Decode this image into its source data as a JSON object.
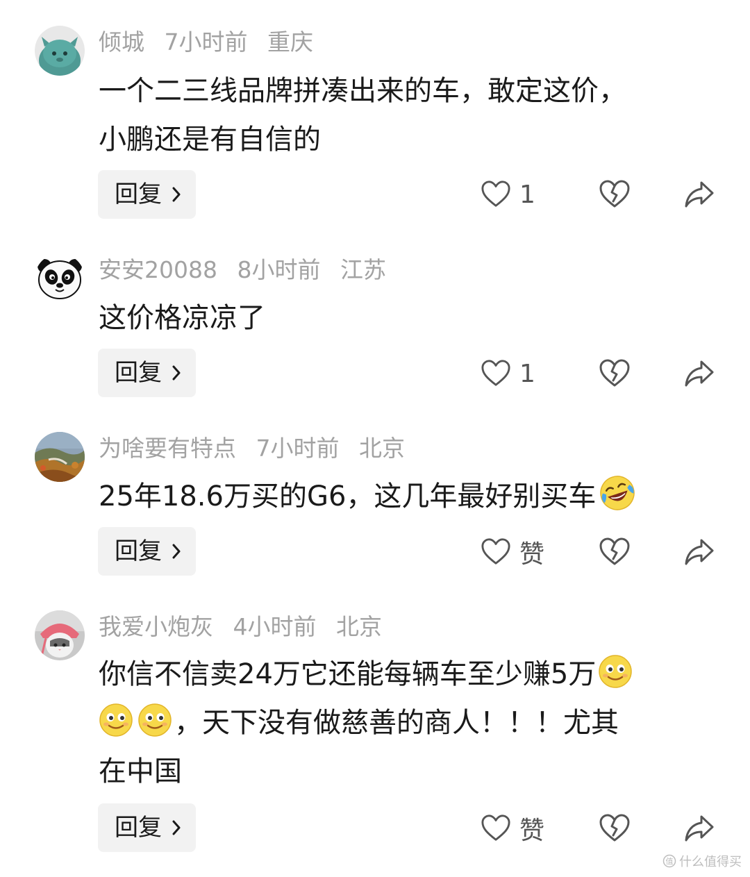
{
  "comments": [
    {
      "username": "倾城",
      "time": "7小时前",
      "location": "重庆",
      "text_line1": "一个二三线品牌拼凑出来的车，敢定这价，",
      "text_line2": "小鹏还是有自信的",
      "reply_label": "回复",
      "like_count": "1",
      "avatar_icon": "green-monster-avatar"
    },
    {
      "username": "安安20088",
      "time": "8小时前",
      "location": "江苏",
      "text_line1": "这价格凉凉了",
      "reply_label": "回复",
      "like_count": "1",
      "avatar_icon": "panda-avatar"
    },
    {
      "username": "为啥要有特点",
      "time": "7小时前",
      "location": "北京",
      "text_line1": "25年18.6万买的G6，这几年最好别买车",
      "reply_label": "回复",
      "like_count": "赞",
      "avatar_icon": "landscape-photo-avatar",
      "emoji": "laughing-crying-emoji"
    },
    {
      "username": "我爱小炮灰",
      "time": "4小时前",
      "location": "北京",
      "text_line1": "你信不信卖24万它还能每辆车至少赚5万",
      "text_line2_rest": "，天下没有做慈善的商人！！！尤其",
      "text_line3": "在中国",
      "reply_label": "回复",
      "like_count": "赞",
      "avatar_icon": "cat-photo-avatar",
      "emoji": "smile-emoji"
    }
  ],
  "watermark": "什么值得买",
  "colors": {
    "meta": "#a2a2a2",
    "text": "#1a1a1a",
    "reply_bg": "#f2f2f2",
    "icon": "#555555"
  }
}
